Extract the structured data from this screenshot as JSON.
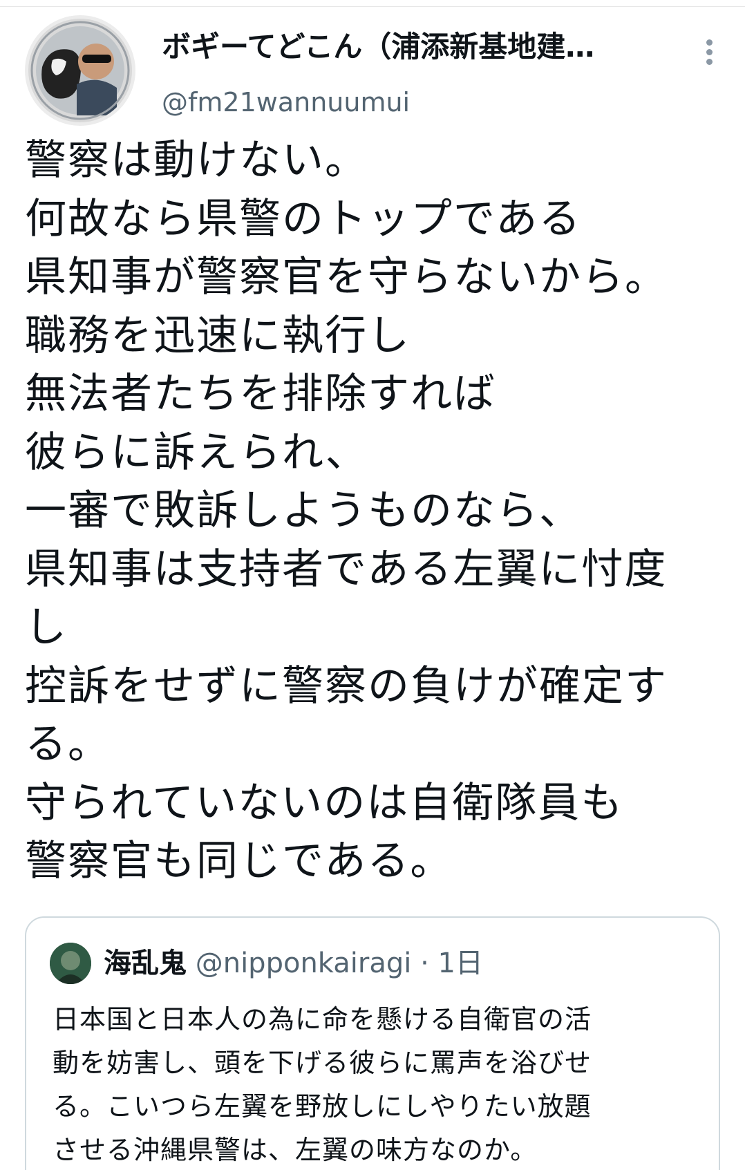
{
  "tweet": {
    "author": {
      "display_name": "ボギーてどこん（浦添新基地建…",
      "handle": "@fm21wannuumui"
    },
    "lines": [
      "警察は動けない。",
      "何故なら県警のトップである",
      "県知事が警察官を守らないから。",
      "職務を迅速に執行し",
      "無法者たちを排除すれば",
      "彼らに訴えられ、",
      "一審で敗訴しようものなら、",
      "県知事は支持者である左翼に忖度",
      "し",
      "控訴をせずに警察の負けが確定す",
      "る。",
      "守られていないのは自衛隊員も",
      "警察官も同じである。"
    ]
  },
  "quoted_tweet": {
    "display_name": "海乱鬼",
    "handle": "@nipponkairagi",
    "separator": "·",
    "time": "1日",
    "lines": [
      "日本国と日本人の為に命を懸ける自衛官の活",
      "動を妨害し、頭を下げる彼らに罵声を浴びせ",
      "る。こいつら左翼を野放しにしやりたい放題",
      "させる沖縄県警は、左翼の味方なのか。"
    ]
  }
}
